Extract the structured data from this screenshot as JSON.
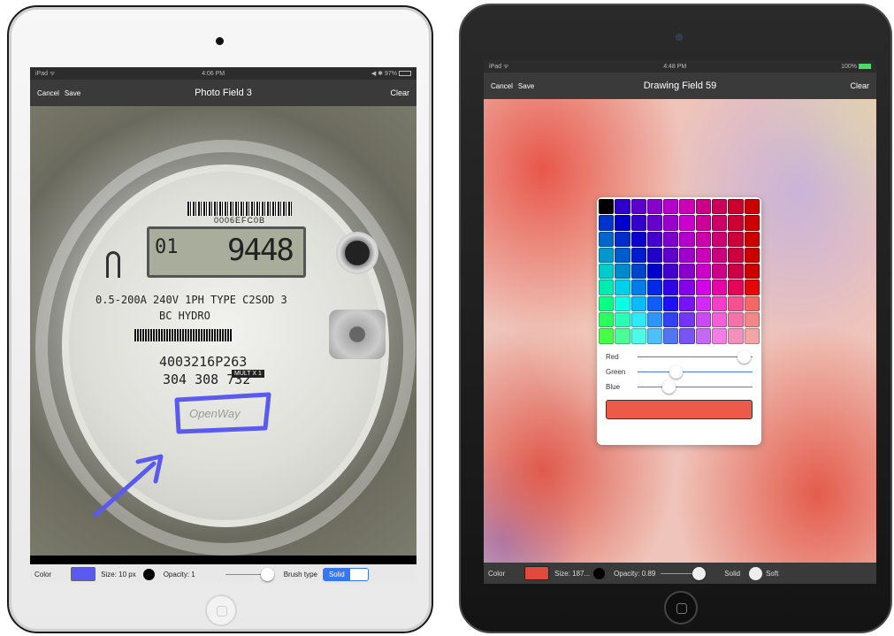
{
  "left_ipad": {
    "status": {
      "carrier": "iPad ᯤ",
      "time": "4:06 PM",
      "battery": "◀ ✱ 97%"
    },
    "nav": {
      "cancel": "Cancel",
      "save": "Save",
      "title": "Photo Field 3",
      "clear": "Clear"
    },
    "photo": {
      "meter_barcode_text": "0006EFC0B",
      "meter_reading_prefix": "01",
      "meter_reading": "9448",
      "spec_line": "0.5-200A 240V  1PH  TYPE C2SOD  3",
      "brand_line": "BC HYDRO",
      "serial_1": "4003216P263",
      "serial_2": "304 308 732",
      "mult_label": "MULT X 1",
      "logo": "OpenWay"
    },
    "toolbar": {
      "color_label": "Color",
      "color_value": "#5a5af0",
      "size_label": "Size: 10 px",
      "opacity_label": "Opacity: 1",
      "opacity_value": 1,
      "brush_label": "Brush type",
      "brush_selected": "Solid"
    }
  },
  "right_ipad": {
    "status": {
      "carrier": "iPad ᯤ",
      "time": "4:48 PM",
      "battery": "100%"
    },
    "nav": {
      "cancel": "Cancel",
      "save": "Save",
      "title": "Drawing Field 59",
      "clear": "Clear"
    },
    "picker": {
      "red_label": "Red",
      "green_label": "Green",
      "blue_label": "Blue",
      "red_value": 0.93,
      "green_value": 0.34,
      "blue_value": 0.28,
      "preview_color": "#ec5a4a"
    },
    "toolbar": {
      "color_label": "Color",
      "color_value": "#e04a3c",
      "size_label": "Size: 187...",
      "opacity_label": "Opacity: 0.89",
      "opacity_value": 0.89,
      "solid_label": "Solid",
      "soft_label": "Soft"
    }
  }
}
